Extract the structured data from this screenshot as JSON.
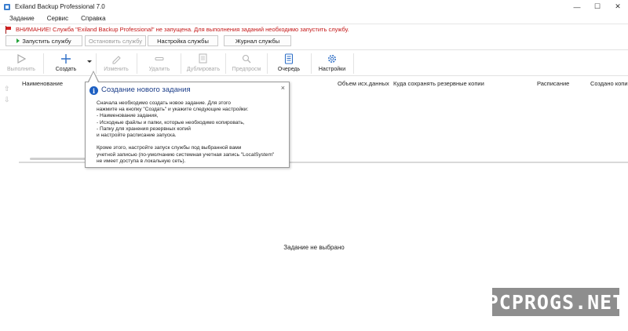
{
  "window": {
    "title": "Exiland Backup Professional 7.0"
  },
  "menu": {
    "items": [
      "Задание",
      "Сервис",
      "Справка"
    ]
  },
  "warning": {
    "text": "ВНИМАНИЕ! Служба \"Exiland Backup Professional\" не запущена. Для выполнения заданий необходимо запустить службу.",
    "color": "#c41616"
  },
  "service_buttons": {
    "start": "Запустить службу",
    "stop": "Остановить службу",
    "settings": "Настройка службы",
    "log": "Журнал службы"
  },
  "toolbar": {
    "run": "Выполнить",
    "create": "Создать",
    "edit": "Изменить",
    "delete": "Удалить",
    "duplicate": "Дублировать",
    "preview": "Предпросм",
    "queue": "Очередь",
    "settings": "Настройки"
  },
  "table": {
    "columns": [
      "Наименование",
      "Объем исх.данных",
      "Куда сохранять резервные копии",
      "Расписание",
      "Создано копи"
    ]
  },
  "tooltip": {
    "title": "Создание нового задания",
    "lines": [
      "Сначала необходимо создать новое задание. Для этого",
      "нажмите на кнопку \"Создать\" и укажите следующие настройки:",
      "- Наименование задания,",
      "- Исходные файлы и папки, которые необходимо копировать,",
      "- Папку для хранения резервных копий",
      "и настройте расписание запуска.",
      "",
      "Кроме этого, настройте запуск службы под выбранной вами",
      "учетной записью (по-умолчанию системная учетная запись \"LocalSystem\"",
      "не имеет доступа в локальную сеть)."
    ]
  },
  "status": {
    "no_task": "Задание не выбрано"
  },
  "watermark": {
    "text": "PCPROGS.NET"
  }
}
